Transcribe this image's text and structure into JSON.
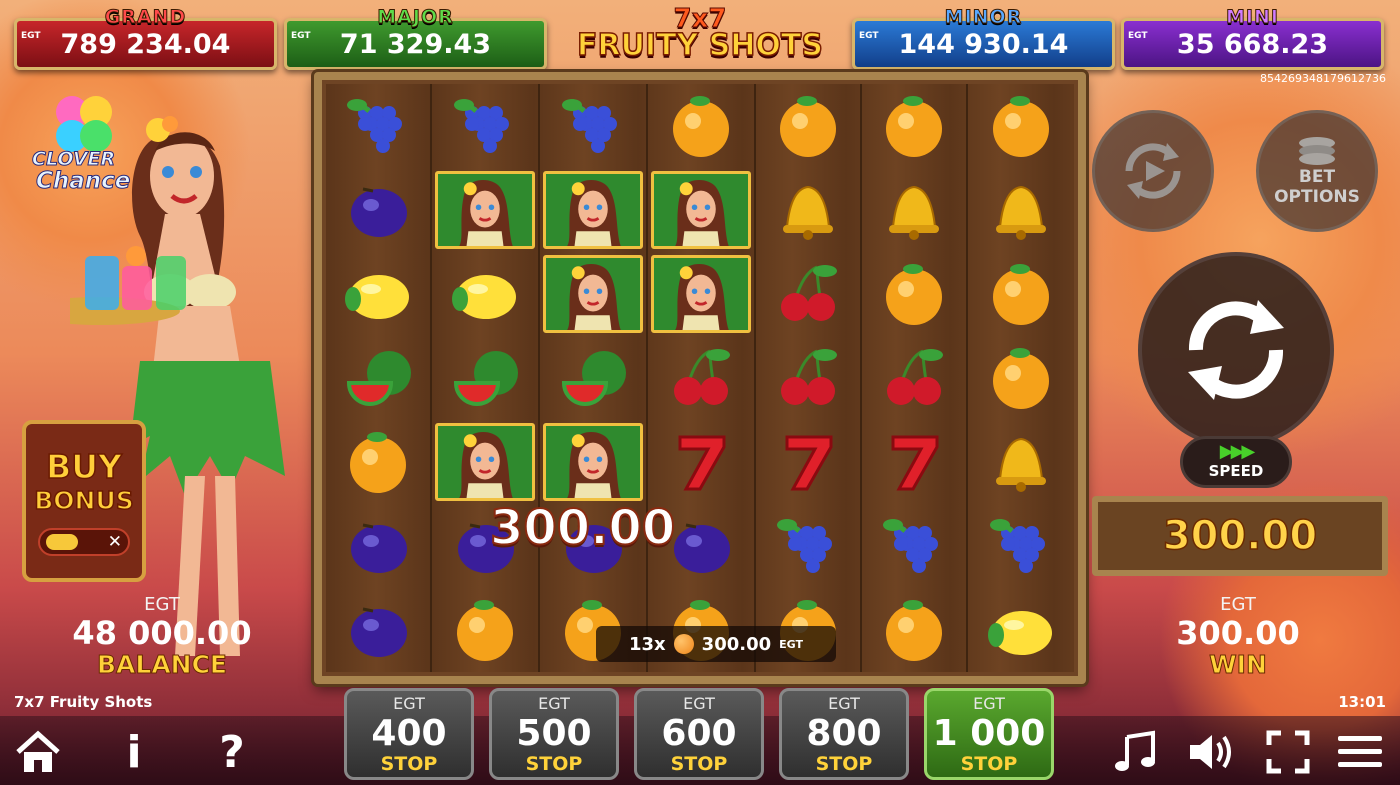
{
  "jackpots": {
    "grand": {
      "name": "GRAND",
      "currency": "EGT",
      "value": "789 234.04"
    },
    "major": {
      "name": "MAJOR",
      "currency": "EGT",
      "value": "71 329.43"
    },
    "minor": {
      "name": "MINOR",
      "currency": "EGT",
      "value": "144 930.14"
    },
    "mini": {
      "name": "MINI",
      "currency": "EGT",
      "value": "35 668.23"
    }
  },
  "logo": {
    "line1": "7x7",
    "line2": "FRUITY SHOTS"
  },
  "ticket_id": "854269348179612736",
  "clover": {
    "line1": "CLOVER",
    "line2": "Chance"
  },
  "buy_bonus": {
    "line1": "BUY",
    "line2": "BONUS",
    "toggle_close": "✕"
  },
  "reels": [
    [
      "grapes",
      "plum",
      "lemon",
      "watermelon",
      "orange",
      "plum",
      "plum"
    ],
    [
      "grapes",
      "girl",
      "lemon",
      "watermelon",
      "girl",
      "plum",
      "orange"
    ],
    [
      "grapes",
      "girl",
      "girl",
      "watermelon",
      "girl",
      "plum",
      "orange"
    ],
    [
      "orange",
      "girl",
      "girl",
      "cherry",
      "seven",
      "plum",
      "orange"
    ],
    [
      "orange",
      "bell",
      "cherry",
      "cherry",
      "seven",
      "grapes",
      "orange"
    ],
    [
      "orange",
      "bell",
      "orange",
      "cherry",
      "seven",
      "grapes",
      "orange"
    ],
    [
      "orange",
      "bell",
      "orange",
      "orange",
      "bell",
      "grapes",
      "lemon"
    ]
  ],
  "win_overlay": "300.00",
  "winline": {
    "count": "13x",
    "amount": "300.00",
    "currency": "EGT"
  },
  "controls": {
    "bet_options_line1": "BET",
    "bet_options_line2": "OPTIONS",
    "speed_arrows": "▶▶▶",
    "speed_label": "SPEED"
  },
  "win_panel": "300.00",
  "balance": {
    "currency": "EGT",
    "value": "48 000.00",
    "label": "BALANCE"
  },
  "win": {
    "currency": "EGT",
    "value": "300.00",
    "label": "WIN"
  },
  "game_title": "7x7 Fruity Shots",
  "clock": "13:01",
  "bets": [
    {
      "currency": "EGT",
      "value": "400",
      "label": "STOP",
      "active": false
    },
    {
      "currency": "EGT",
      "value": "500",
      "label": "STOP",
      "active": false
    },
    {
      "currency": "EGT",
      "value": "600",
      "label": "STOP",
      "active": false
    },
    {
      "currency": "EGT",
      "value": "800",
      "label": "STOP",
      "active": false
    },
    {
      "currency": "EGT",
      "value": "1 000",
      "label": "STOP",
      "active": true
    }
  ],
  "menu": {
    "info_glyph": "i",
    "help_glyph": "?"
  },
  "icons": [
    "home-icon",
    "info-icon",
    "help-icon",
    "music-icon",
    "volume-icon",
    "fullscreen-icon",
    "menu-icon"
  ]
}
